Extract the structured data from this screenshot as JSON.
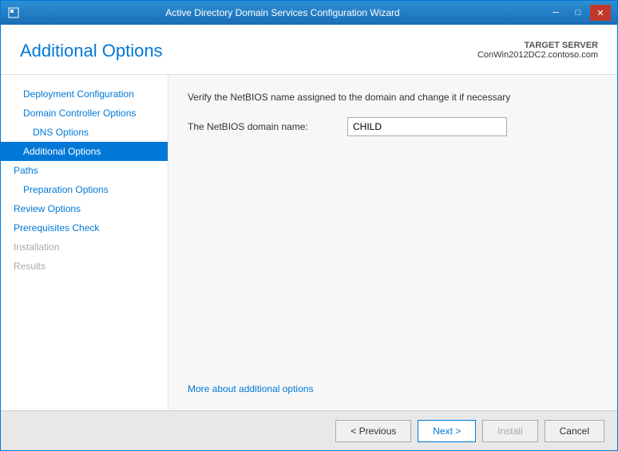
{
  "window": {
    "title": "Active Directory Domain Services Configuration Wizard",
    "minimize_label": "─",
    "maximize_label": "□",
    "close_label": "✕"
  },
  "header": {
    "page_title": "Additional Options",
    "target_server_label": "TARGET SERVER",
    "target_server_name": "ConWin2012DC2.contoso.com"
  },
  "sidebar": {
    "items": [
      {
        "id": "deployment-configuration",
        "label": "Deployment Configuration",
        "indent": "indented",
        "state": "normal"
      },
      {
        "id": "domain-controller-options",
        "label": "Domain Controller Options",
        "indent": "indented",
        "state": "normal"
      },
      {
        "id": "dns-options",
        "label": "DNS Options",
        "indent": "indented2",
        "state": "normal"
      },
      {
        "id": "additional-options",
        "label": "Additional Options",
        "indent": "indented",
        "state": "active"
      },
      {
        "id": "paths",
        "label": "Paths",
        "indent": "normal",
        "state": "normal"
      },
      {
        "id": "preparation-options",
        "label": "Preparation Options",
        "indent": "indented",
        "state": "normal"
      },
      {
        "id": "review-options",
        "label": "Review Options",
        "indent": "normal",
        "state": "normal"
      },
      {
        "id": "prerequisites-check",
        "label": "Prerequisites Check",
        "indent": "normal",
        "state": "normal"
      },
      {
        "id": "installation",
        "label": "Installation",
        "indent": "normal",
        "state": "disabled"
      },
      {
        "id": "results",
        "label": "Results",
        "indent": "normal",
        "state": "disabled"
      }
    ]
  },
  "content": {
    "description": "Verify the NetBIOS name assigned to the domain and change it if necessary",
    "netbios_label": "The NetBIOS domain name:",
    "netbios_value": "CHILD",
    "more_link": "More about additional options"
  },
  "footer": {
    "previous_label": "< Previous",
    "next_label": "Next >",
    "install_label": "Install",
    "cancel_label": "Cancel"
  }
}
